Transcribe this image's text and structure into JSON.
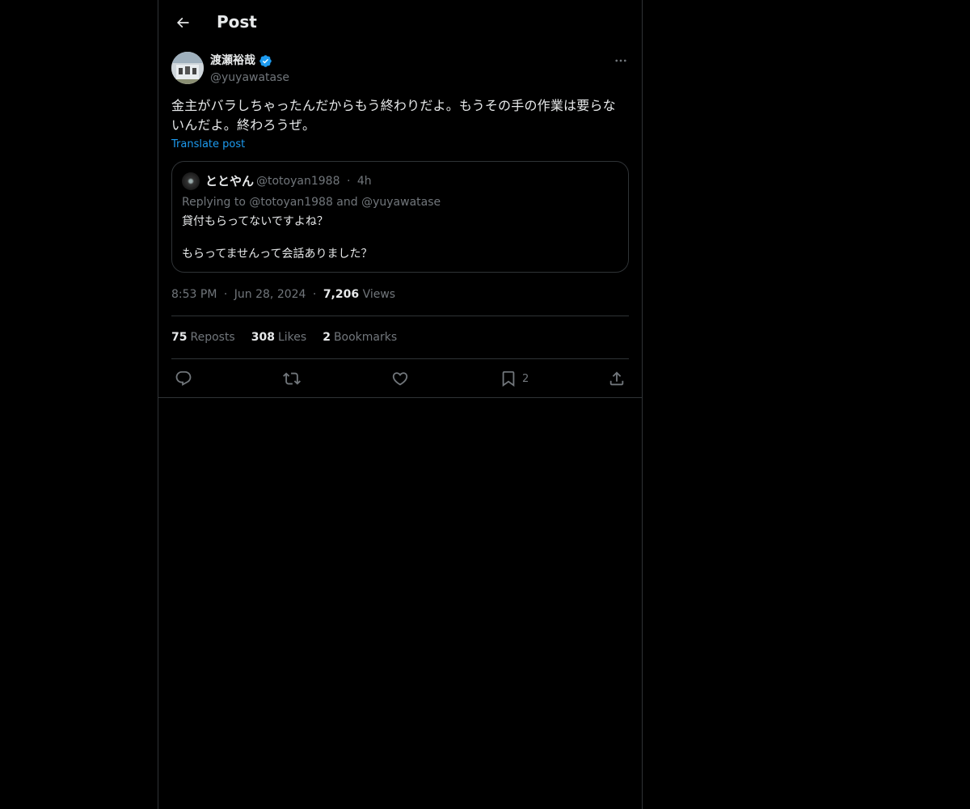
{
  "header": {
    "title": "Post"
  },
  "author": {
    "name": "渡瀬裕哉",
    "handle": "@yuyawatase"
  },
  "post": {
    "text": "金主がバラしちゃったんだからもう終わりだよ。もうその手の作業は要らないんだよ。終わろうぜ。",
    "translate_label": "Translate post"
  },
  "quote": {
    "name": "ととやん",
    "handle": "@totoyan1988",
    "separator": "·",
    "time": "4h",
    "replying": "Replying to @totoyan1988 and @yuyawatase",
    "line1": "貸付もらってないですよね？",
    "line2": "もらってませんって会話ありました？"
  },
  "meta": {
    "time": "8:53 PM",
    "date": "Jun 28, 2024",
    "views_count": "7,206",
    "views_label": "Views",
    "separator": "·"
  },
  "stats": {
    "reposts_count": "75",
    "reposts_label": "Reposts",
    "likes_count": "308",
    "likes_label": "Likes",
    "bookmarks_count": "2",
    "bookmarks_label": "Bookmarks"
  },
  "actions": {
    "bookmark_count": "2"
  },
  "icons": [
    "back-arrow-icon",
    "verified-badge-icon",
    "more-icon",
    "reply-icon",
    "repost-icon",
    "like-icon",
    "bookmark-icon",
    "share-icon"
  ],
  "colors": {
    "background": "#000000",
    "accent": "#1d9bf0",
    "text": "#e7e9ea",
    "muted": "#71767b",
    "border": "#2f3336"
  }
}
